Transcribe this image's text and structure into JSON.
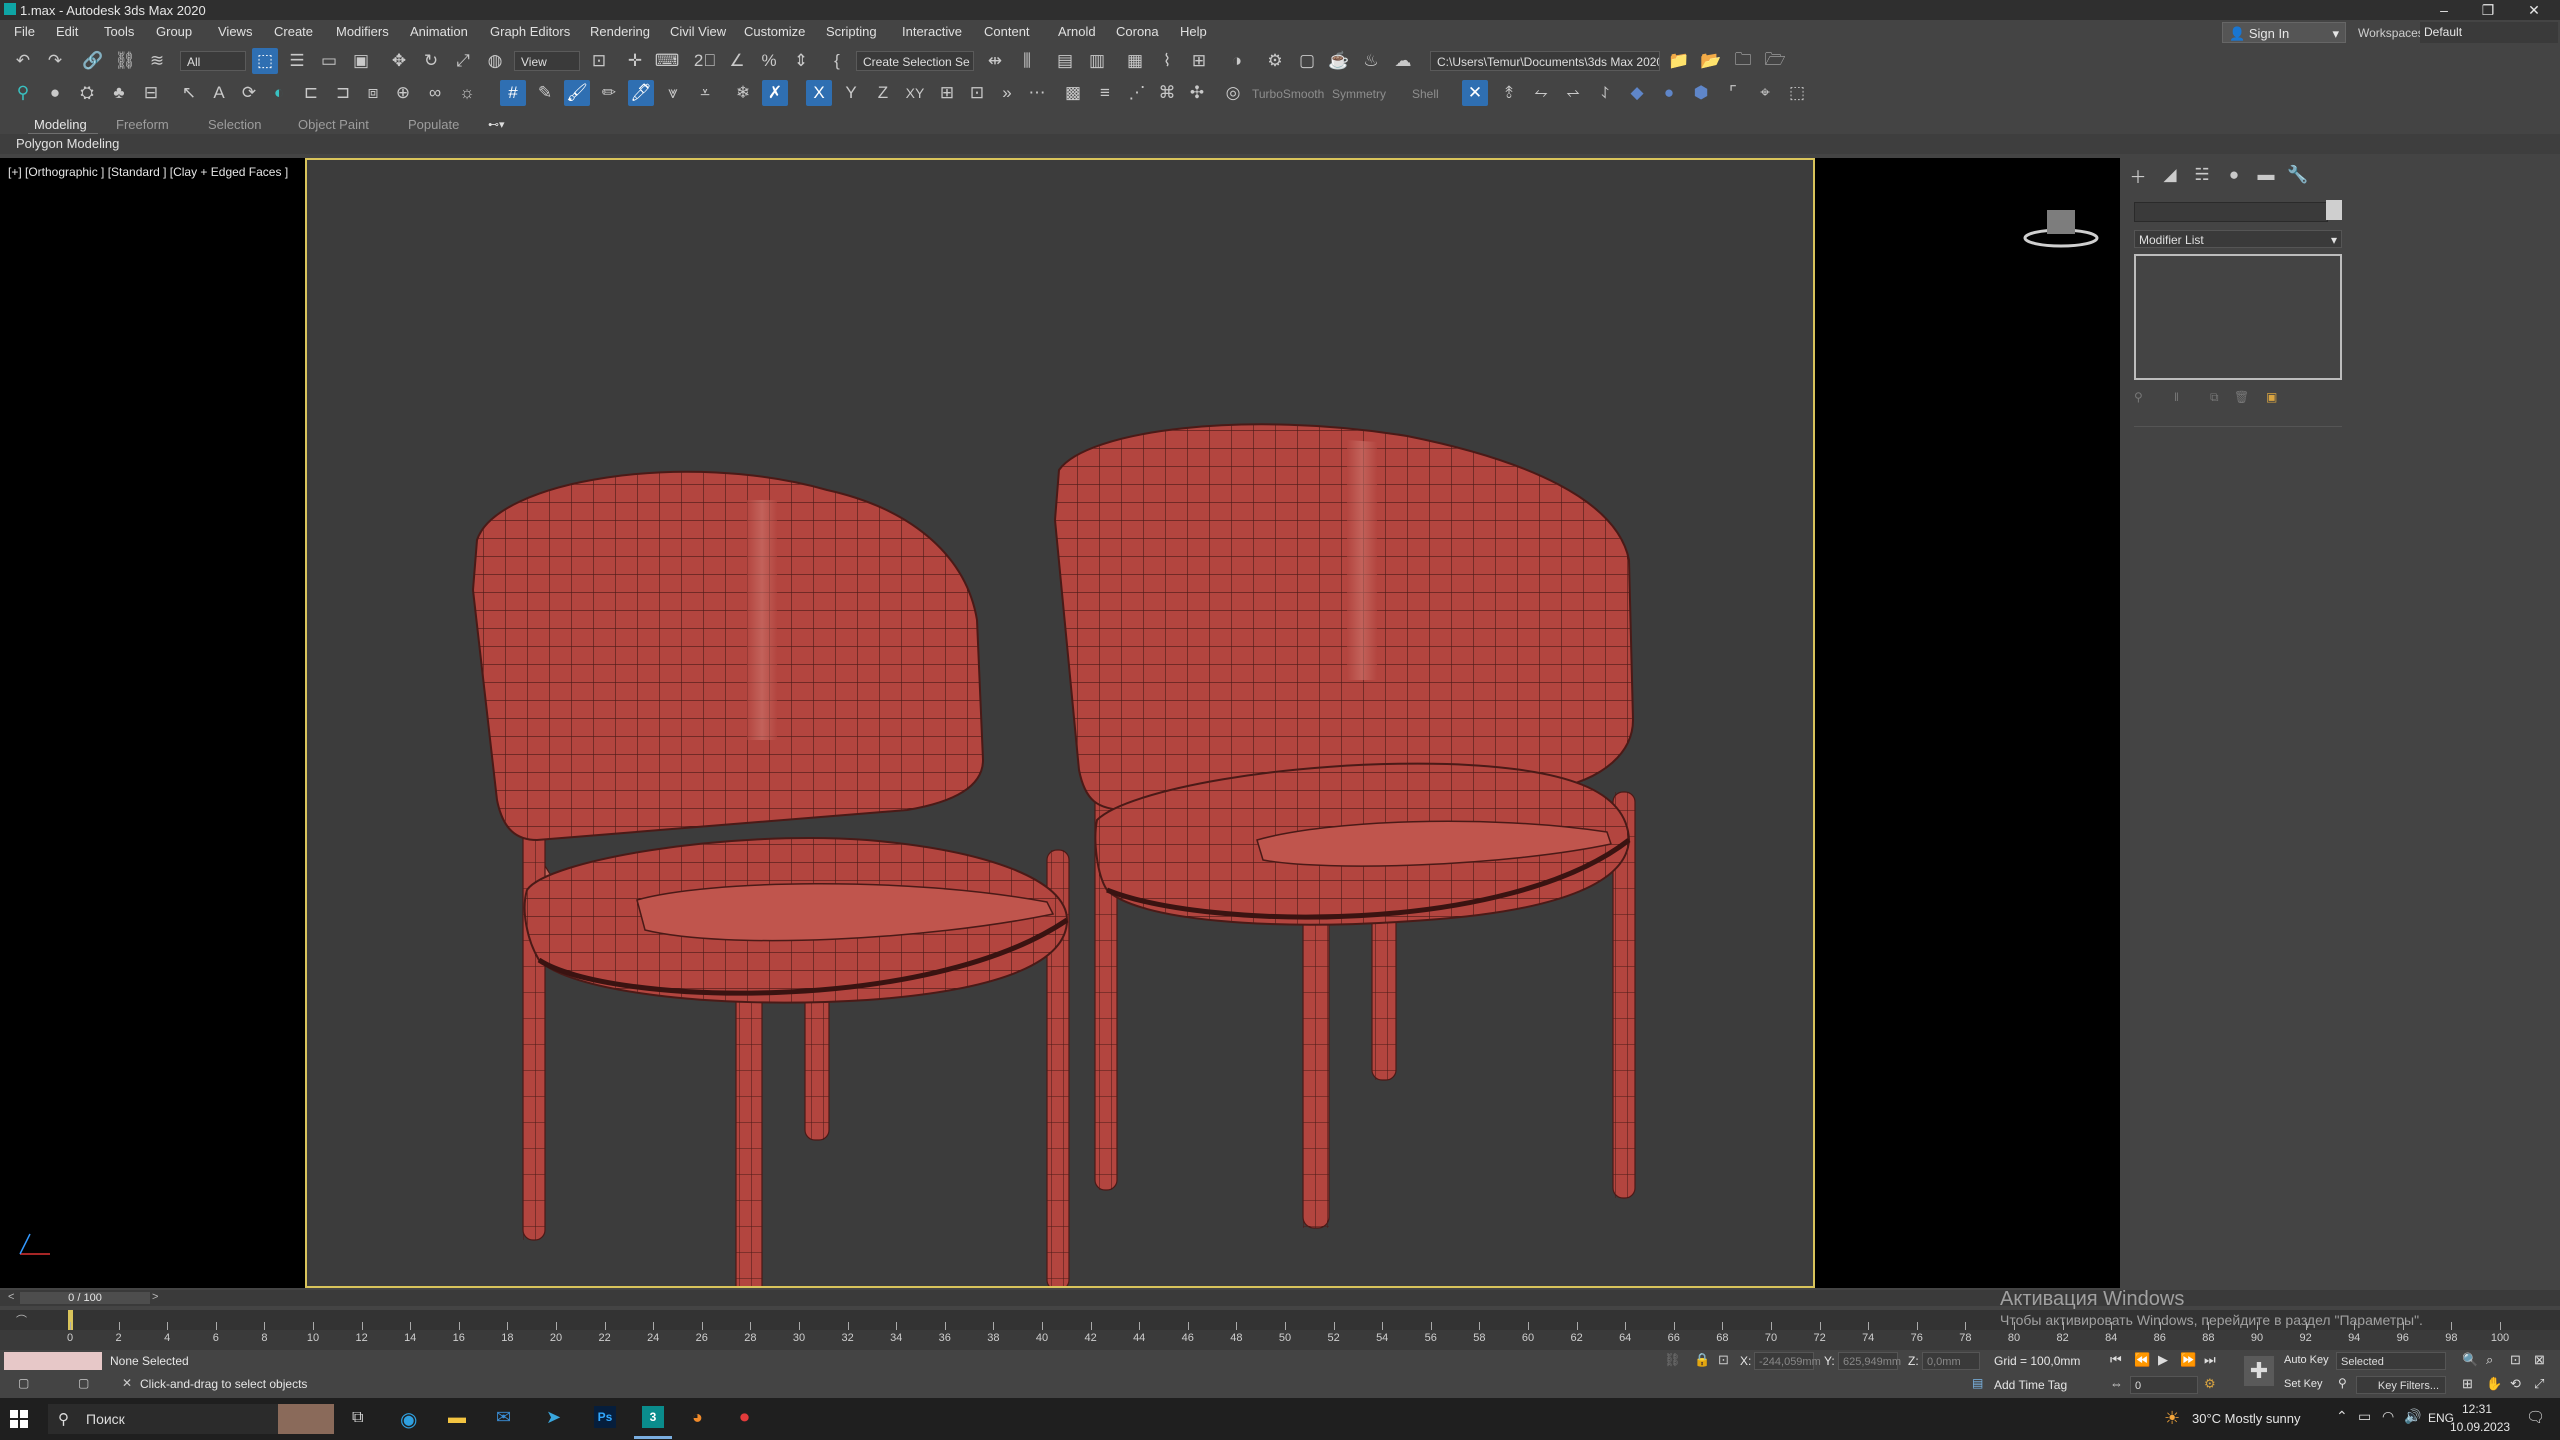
{
  "window": {
    "title": "1.max - Autodesk 3ds Max 2020",
    "minimize": "–",
    "restore": "❐",
    "close": "✕"
  },
  "menubar": {
    "items": [
      "File",
      "Edit",
      "Tools",
      "Group",
      "Views",
      "Create",
      "Modifiers",
      "Animation",
      "Graph Editors",
      "Rendering",
      "Civil View",
      "Customize",
      "Scripting",
      "Interactive",
      "Content",
      "Arnold",
      "Corona",
      "Help"
    ],
    "sign_in": "Sign In",
    "workspaces_label": "Workspaces:",
    "workspaces_value": "Default"
  },
  "toolbar": {
    "selection_filter": "All",
    "ref_coord": "View",
    "named_selection": "Create Selection Se",
    "project_path": "C:\\Users\\Temur\\Documents\\3ds Max 2020",
    "modifier_shortcuts": [
      "TurboSmooth",
      "Symmetry",
      "Shell"
    ],
    "axis_constraints": [
      "X",
      "Y",
      "Z",
      "XY"
    ]
  },
  "ribbon": {
    "tabs": [
      "Modeling",
      "Freeform",
      "Selection",
      "Object Paint",
      "Populate"
    ],
    "active_tab": "Modeling",
    "subtitle": "Polygon Modeling"
  },
  "viewport": {
    "label": "[+] [Orthographic ] [Standard ] [Clay + Edged Faces ]"
  },
  "command_panel": {
    "modifier_list": "Modifier List"
  },
  "timeline": {
    "frame_display": "0 / 100",
    "ticks": [
      0,
      2,
      4,
      6,
      8,
      10,
      12,
      14,
      16,
      18,
      20,
      22,
      24,
      26,
      28,
      30,
      32,
      34,
      36,
      38,
      40,
      42,
      44,
      46,
      48,
      50,
      52,
      54,
      56,
      58,
      60,
      62,
      64,
      66,
      68,
      70,
      72,
      74,
      76,
      78,
      80,
      82,
      84,
      86,
      88,
      90,
      92,
      94,
      96,
      98,
      100
    ]
  },
  "status": {
    "selection": "None Selected",
    "prompt": "Click-and-drag to select objects",
    "x_label": "X:",
    "x_value": "-244,059mm",
    "y_label": "Y:",
    "y_value": "625,949mm",
    "z_label": "Z:",
    "z_value": "0,0mm",
    "grid": "Grid = 100,0mm",
    "add_time_tag": "Add Time Tag",
    "auto_key": "Auto Key",
    "key_mode": "Selected",
    "set_key": "Set Key",
    "key_filters": "Key Filters...",
    "frame": "0"
  },
  "watermark": {
    "line1": "Активация Windows",
    "line2": "Чтобы активировать Windows, перейдите в раздел \"Параметры\"."
  },
  "taskbar": {
    "search": "Поиск",
    "weather": "30°C  Mostly sunny",
    "lang": "ENG",
    "time": "12:31",
    "date": "10.09.2023"
  },
  "colors": {
    "chair": "#b3453f",
    "viewport_border": "#d9c45b",
    "accent": "#2f6fb2"
  }
}
